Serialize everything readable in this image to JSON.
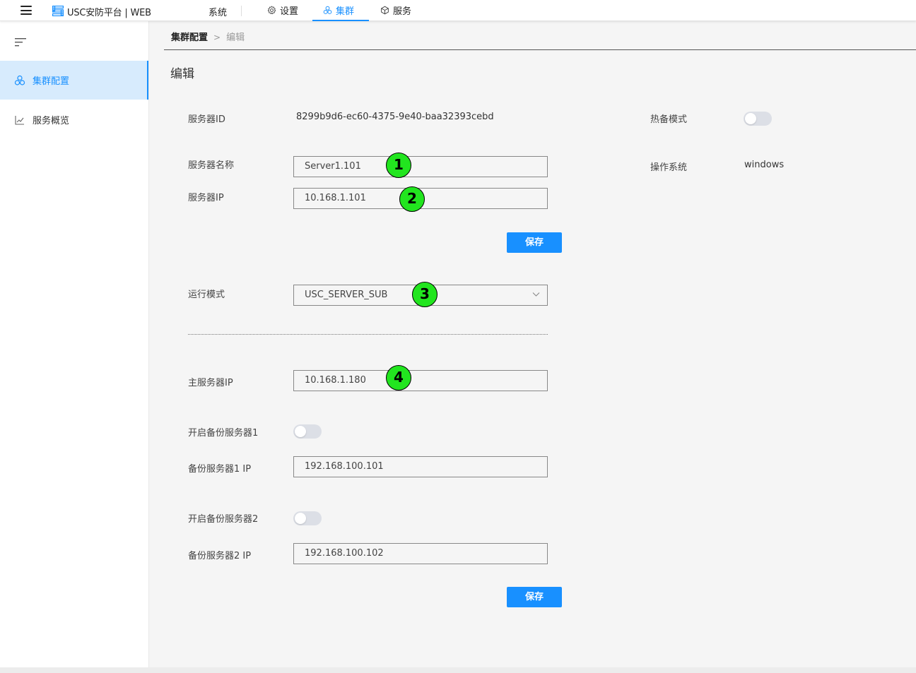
{
  "topbar": {
    "brand": "USC安防平台 | WEB",
    "nav_system": "系统",
    "nav_settings": "设置",
    "nav_cluster": "集群",
    "nav_services": "服务"
  },
  "sidebar": {
    "items": [
      {
        "label": "集群配置",
        "icon": "cluster-icon",
        "active": true
      },
      {
        "label": "服务概览",
        "icon": "chart-line-icon",
        "active": false
      }
    ]
  },
  "breadcrumb": {
    "section": "集群配置",
    "separator": ">",
    "current": "编辑"
  },
  "page": {
    "title": "编辑"
  },
  "form": {
    "server_id_label": "服务器ID",
    "server_id_value": "8299b9d6-ec60-4375-9e40-baa32393cebd",
    "hot_standby_label": "热备模式",
    "hot_standby_on": false,
    "os_label": "操作系统",
    "os_value": "windows",
    "server_name_label": "服务器名称",
    "server_name_value": "Server1.101",
    "server_ip_label": "服务器IP",
    "server_ip_value": "10.168.1.101",
    "save_label": "保存",
    "run_mode_label": "运行模式",
    "run_mode_value": "USC_SERVER_SUB",
    "master_ip_label": "主服务器IP",
    "master_ip_value": "10.168.1.180",
    "backup1_enable_label": "开启备份服务器1",
    "backup1_enabled": false,
    "backup1_ip_label": "备份服务器1 IP",
    "backup1_ip_value": "192.168.100.101",
    "backup2_enable_label": "开启备份服务器2",
    "backup2_enabled": false,
    "backup2_ip_label": "备份服务器2 IP",
    "backup2_ip_value": "192.168.100.102",
    "save2_label": "保存"
  },
  "annotations": {
    "b1": "1",
    "b2": "2",
    "b3": "3",
    "b4": "4"
  },
  "colors": {
    "accent": "#1890ff",
    "active_bg": "#d7ebfd",
    "badge": "#22e51f"
  }
}
